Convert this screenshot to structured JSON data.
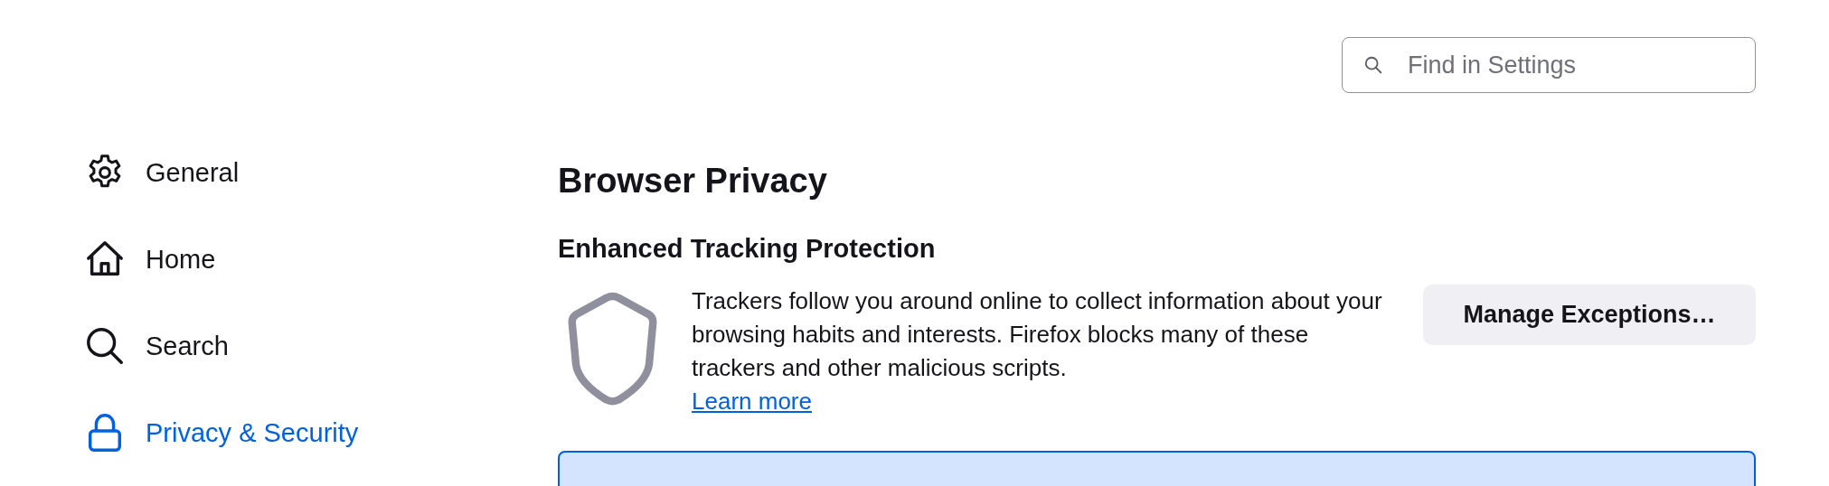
{
  "search": {
    "placeholder": "Find in Settings"
  },
  "sidebar": {
    "items": [
      {
        "label": "General",
        "kind": "gear",
        "selected": false
      },
      {
        "label": "Home",
        "kind": "home",
        "selected": false
      },
      {
        "label": "Search",
        "kind": "search",
        "selected": false
      },
      {
        "label": "Privacy & Security",
        "kind": "lock",
        "selected": true
      }
    ]
  },
  "page_title": "Browser Privacy",
  "section": {
    "title": "Enhanced Tracking Protection",
    "description": "Trackers follow you around online to collect information about your browsing habits and interests. Firefox blocks many of these trackers and other malicious scripts.",
    "link": "Learn more",
    "button": "Manage Exceptions…",
    "options": [
      {
        "selected": true
      }
    ]
  }
}
